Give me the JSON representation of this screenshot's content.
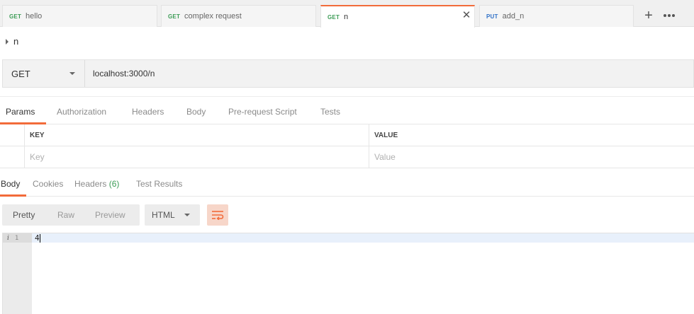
{
  "tabs": [
    {
      "method": "GET",
      "name": "hello",
      "active": false
    },
    {
      "method": "GET",
      "name": "complex request",
      "active": false
    },
    {
      "method": "GET",
      "name": "n",
      "active": true,
      "close_glyph": "✕"
    },
    {
      "method": "PUT",
      "name": "add_n",
      "active": false
    }
  ],
  "toolbar": {
    "new_tab_glyph": "+",
    "more_icon": "more-horizontal-icon"
  },
  "request": {
    "name": "n",
    "method": "GET",
    "url": "localhost:3000/n"
  },
  "request_tabs": [
    "Params",
    "Authorization",
    "Headers",
    "Body",
    "Pre-request Script",
    "Tests"
  ],
  "request_tabs_active": "Params",
  "params": {
    "headers": {
      "key": "KEY",
      "value": "VALUE"
    },
    "placeholder": {
      "key": "Key",
      "value": "Value"
    }
  },
  "response_tabs": {
    "body": "Body",
    "cookies": "Cookies",
    "headers": "Headers",
    "headers_count": "(6)",
    "test_results": "Test Results"
  },
  "response_view": {
    "modes": [
      "Pretty",
      "Raw",
      "Preview"
    ],
    "active_mode": "Pretty",
    "format": "HTML",
    "wrap_icon": "wrap-lines-icon"
  },
  "editor": {
    "info_glyph": "i",
    "line_number": "1",
    "content": "4"
  },
  "colors": {
    "accent": "#f26b3a",
    "get": "#3c9c56",
    "put": "#2f70c7"
  }
}
